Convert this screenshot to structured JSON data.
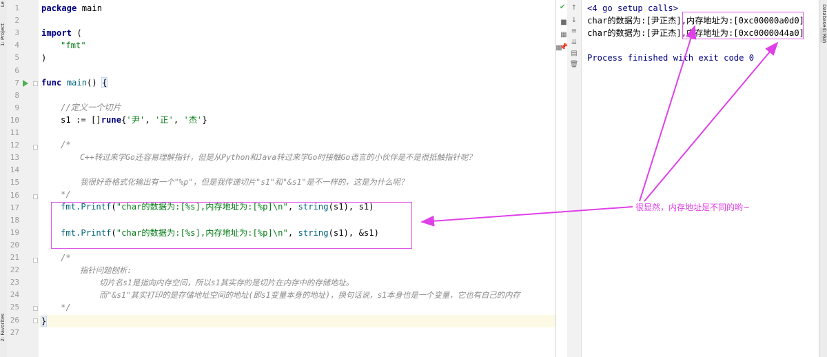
{
  "tool_tabs": {
    "left_top": "Le",
    "project": "1: Project",
    "favorites": "2: Favorites",
    "database": "Database",
    "run": "4: Run"
  },
  "editor": {
    "line_numbers": [
      "1",
      "2",
      "3",
      "4",
      "5",
      "6",
      "7",
      "8",
      "9",
      "10",
      "11",
      "12",
      "13",
      "14",
      "15",
      "16",
      "17",
      "18",
      "19",
      "20",
      "21",
      "22",
      "23",
      "24",
      "25",
      "26",
      "27"
    ],
    "lines": {
      "l1_kw": "package",
      "l1_name": " main",
      "l3_kw": "import",
      "l3_rest": " (",
      "l4": "\"fmt\"",
      "l5": ")",
      "l7_kw": "func",
      "l7_name": " main",
      "l7_paren": "() ",
      "l7_brace": "{",
      "l9": "//定义一个切片",
      "l10_a": "s1 := []",
      "l10_b": "rune",
      "l10_c": "{",
      "l10_s1": "'尹'",
      "l10_sep1": ", ",
      "l10_s2": "'正'",
      "l10_sep2": ", ",
      "l10_s3": "'杰'",
      "l10_d": "}",
      "l12": "/*",
      "l13": "C++转过来学Go还容易理解指针，但是从Python和Java转过来学Go时接触Go语言的小伙伴是不是很抵触指针呢？",
      "l15": "我很好奇格式化输出有一个\"%p\"，但是我传递切片\"s1\"和\"&s1\"是不一样的，这是为什么呢？",
      "l16": "*/",
      "l17_pkg": "fmt.",
      "l17_fn": "Printf",
      "l17_open": "(",
      "l17_str": "\"char的数据为:[%s],内存地址为:[%p]\\n\"",
      "l17_mid": ", ",
      "l17_fn2": "string",
      "l17_rest": "(s1), s1)",
      "l19_pkg": "fmt.",
      "l19_fn": "Printf",
      "l19_open": "(",
      "l19_str": "\"char的数据为:[%s],内存地址为:[%p]\\n\"",
      "l19_mid": ", ",
      "l19_fn2": "string",
      "l19_rest": "(s1), &s1)",
      "l21": "/*",
      "l22": "指针问题刨析:",
      "l23": "切片名s1是指向内存空间，所以s1其实存的是切片在内存中的存储地址。",
      "l24": "而\"&s1\"其实打印的是存储地址空间的地址(即s1变量本身的地址)，换句话说，s1本身也是一个变量，它也有自己的内存",
      "l25": "*/",
      "l26": "}"
    }
  },
  "run_output": {
    "header": "<4 go setup calls>",
    "line1_a": "char的数据为:[尹正杰]",
    "line1_b": ",内存地址为:[0xc00000a0d0]",
    "line2_a": "char的数据为:[尹正杰]",
    "line2_b": ",内存地址为:[0xc0000044a0]",
    "finished": "Process finished with exit code 0"
  },
  "toolbar_icons": [
    "up-arrow-icon",
    "down-arrow-icon",
    "soft-wrap-icon",
    "scroll-to-end-icon",
    "print-icon",
    "trash-icon",
    "pin-icon"
  ],
  "annotation": {
    "text": "很显然，内存地址是不同的哟~",
    "color": "#e040e8"
  },
  "colors": {
    "keyword": "#000080",
    "string": "#067d17",
    "comment": "#8c8c8c",
    "function": "#00627a",
    "output_header": "#000080"
  }
}
